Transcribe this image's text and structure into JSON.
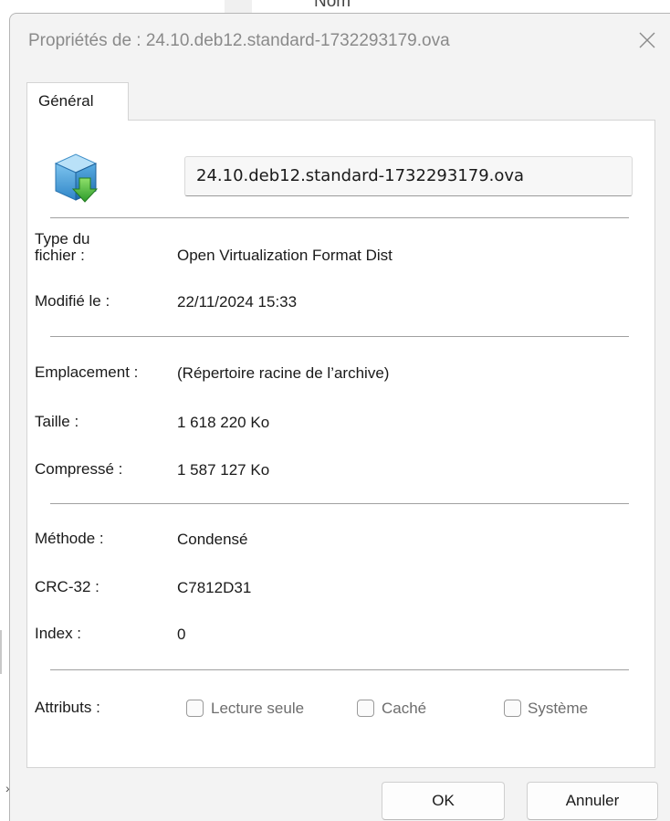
{
  "background": {
    "column_header": "Nom"
  },
  "dialog": {
    "title": "Propriétés de : 24.10.deb12.standard-1732293179.ova",
    "close_glyph": "✕",
    "tabs": [
      {
        "label": "Général"
      }
    ],
    "file_icon": "package-icon",
    "file_name": "24.10.deb12.standard-1732293179.ova",
    "properties": {
      "type_label_line1": "Type du",
      "type_label_line2": "fichier :",
      "type_value": "Open Virtualization Format Dist",
      "modified_label": "Modifié le :",
      "modified_value": "22/11/2024 15:33",
      "location_label": "Emplacement :",
      "location_value": "(Répertoire racine de l’archive)",
      "size_label": "Taille :",
      "size_value": "1 618 220 Ko",
      "compressed_label": "Compressé :",
      "compressed_value": "1 587 127 Ko",
      "method_label": "Méthode :",
      "method_value": "Condensé",
      "crc_label": "CRC-32 :",
      "crc_value": "C7812D31",
      "index_label": "Index :",
      "index_value": "0"
    },
    "attributes": {
      "label": "Attributs :",
      "read_only": {
        "label": "Lecture seule",
        "checked": false
      },
      "hidden": {
        "label": "Caché",
        "checked": false
      },
      "system": {
        "label": "Système",
        "checked": false
      }
    },
    "buttons": {
      "ok": "OK",
      "cancel": "Annuler"
    }
  }
}
